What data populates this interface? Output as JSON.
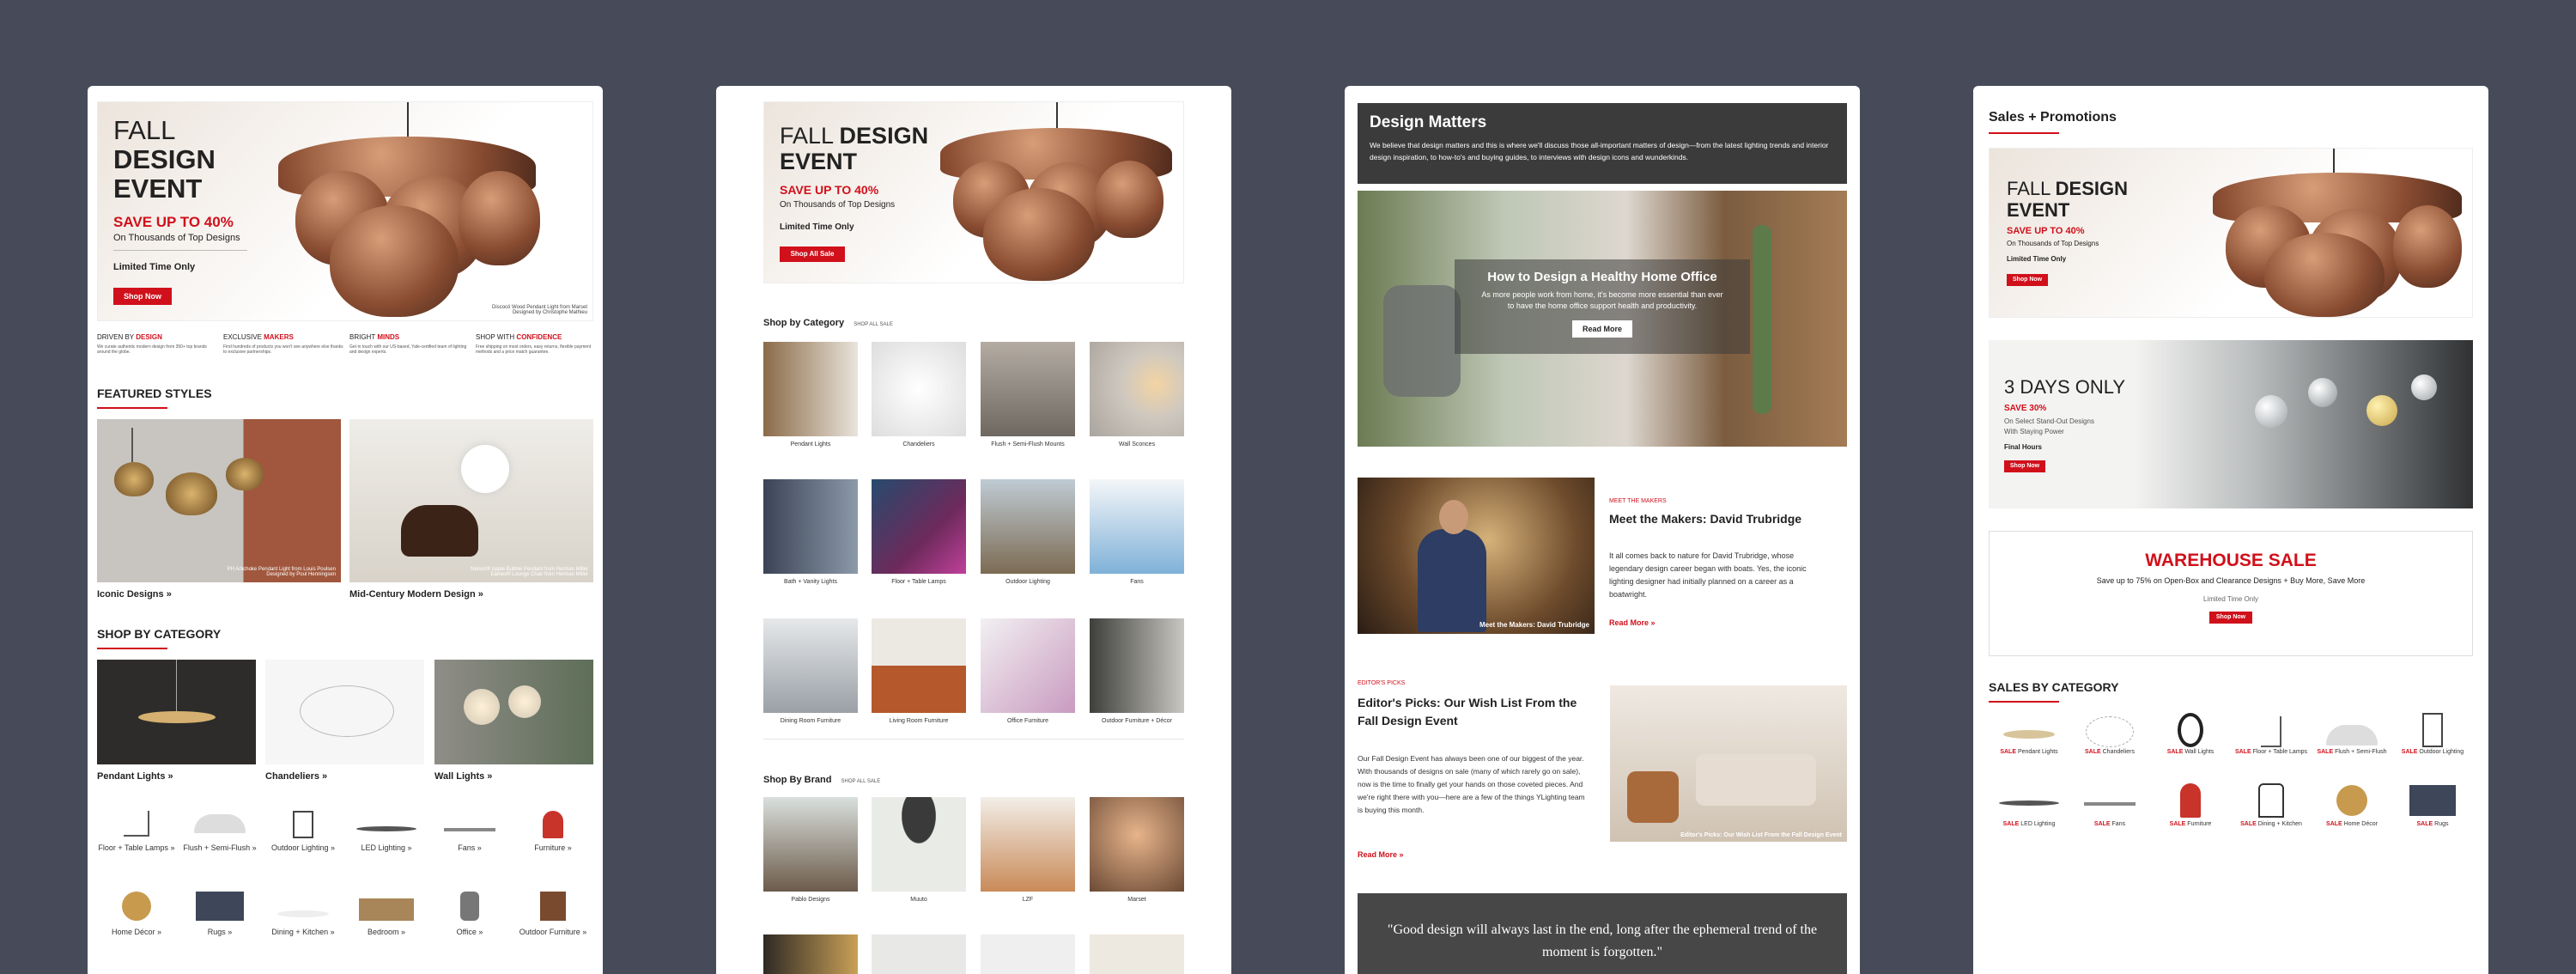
{
  "panel1": {
    "hero": {
      "fall": "FALL",
      "design": "DESIGN",
      "event": "EVENT",
      "save": "SAVE UP TO 40%",
      "sub": "On Thousands of Top Designs",
      "limited": "Limited Time Only",
      "button": "Shop Now",
      "credit": "Discocó Wood Pendant Light from Marset",
      "credit2": "Designed by Christophe Mathieu"
    },
    "values": [
      {
        "pre": "DRIVEN BY ",
        "key": "DESIGN",
        "text": "We curate authentic modern design from 350+ top brands around the globe."
      },
      {
        "pre": "EXCLUSIVE ",
        "key": "MAKERS",
        "text": "Find hundreds of products you won't see anywhere else thanks to exclusive partnerships."
      },
      {
        "pre": "BRIGHT ",
        "key": "MINDS",
        "text": "Get in touch with our US-based, Yale-certified team of lighting and design experts."
      },
      {
        "pre": "SHOP WITH ",
        "key": "CONFIDENCE",
        "text": "Free shipping on most orders, easy returns, flexible payment methods and a price match guarantee."
      }
    ],
    "featured_title": "FEATURED STYLES",
    "featured": [
      {
        "label": "Iconic Designs »",
        "overlay": "PH Artichoke Pendant Light from Louis Poulsen",
        "overlay2": "Designed by Poul Henningsen"
      },
      {
        "label": "Mid-Century Modern Design »",
        "overlay": "Nelson® Apple Bubble Pendant from Herman Miller",
        "overlay2": "Eames® Lounge Chair from Herman Miller"
      }
    ],
    "category_title": "SHOP BY CATEGORY",
    "categories": [
      "Pendant Lights »",
      "Chandeliers »",
      "Wall Lights »"
    ],
    "small": [
      "Floor + Table Lamps »",
      "Flush + Semi-Flush »",
      "Outdoor Lighting »",
      "LED Lighting »",
      "Fans »",
      "Furniture »",
      "Home Décor »",
      "Rugs »",
      "Dining + Kitchen »",
      "Bedroom »",
      "Office »",
      "Outdoor Furniture »"
    ]
  },
  "panel2": {
    "hero": {
      "fall": "FALL ",
      "design": "DESIGN",
      "event": "EVENT",
      "save": "SAVE UP TO 40%",
      "sub": "On Thousands of Top Designs",
      "limited": "Limited Time Only",
      "button": "Shop All Sale"
    },
    "cat_title": "Shop by Category",
    "cat_link": "SHOP ALL SALE",
    "categories": [
      "Pendant Lights",
      "Chandeliers",
      "Flush + Semi-Flush Mounts",
      "Wall Sconces",
      "Bath + Vanity Lights",
      "Floor + Table Lamps",
      "Outdoor Lighting",
      "Fans",
      "Dining Room Furniture",
      "Living Room Furniture",
      "Office Furniture",
      "Outdoor Furniture + Décor"
    ],
    "brand_title": "Shop By Brand",
    "brand_link": "SHOP ALL SALE",
    "brands": [
      "Pablo Designs",
      "Muuto",
      "LZF",
      "Marset"
    ]
  },
  "panel3": {
    "header_title": "Design Matters",
    "header_text": "We believe that design matters and this is where we'll discuss those all-important matters of design—from the latest lighting trends and interior design inspiration, to how-to's and buying guides, to interviews with design icons and wunderkinds.",
    "feature": {
      "title": "How to Design a Healthy Home Office",
      "text": "As more people work from home, it's become more essential than ever to have the home office support health and productivity.",
      "button": "Read More"
    },
    "makers": {
      "tag": "MEET THE MAKERS",
      "title": "Meet the Makers: David Trubridge",
      "text": "It all comes back to nature for David Trubridge, whose legendary design career began with boats. Yes, the iconic lighting designer had initially planned on a career as a boatwright.",
      "link": "Read More »",
      "caption": "Meet the Makers: David Trubridge"
    },
    "picks": {
      "tag": "EDITOR'S PICKS",
      "title": "Editor's Picks: Our Wish List From the Fall Design Event",
      "text": "Our Fall Design Event has always been one of our biggest of the year. With thousands of designs on sale (many of which rarely go on sale), now is the time to finally get your hands on those coveted pieces. And we're right there with you—here are a few of the things YLighting team is buying this month.",
      "link": "Read More »",
      "caption": "Editor's Picks: Our Wish List From the Fall Design Event"
    },
    "quote": "\"Good design will always last in the end, long after the ephemeral trend of the moment is forgotten.\""
  },
  "panel4": {
    "title": "Sales + Promotions",
    "hero": {
      "fall": "FALL ",
      "design": "DESIGN",
      "event": "EVENT",
      "save": "SAVE UP TO 40%",
      "sub": "On Thousands of Top Designs",
      "limited": "Limited Time Only",
      "button": "Shop Now"
    },
    "promo": {
      "title": "3 DAYS ONLY",
      "save": "SAVE 30%",
      "sub": "On Select Stand-Out Designs",
      "sub2": "With Staying Power",
      "final": "Final Hours",
      "button": "Shop Now"
    },
    "warehouse": {
      "title": "WAREHOUSE SALE",
      "text": "Save up to 75% on Open-Box and Clearance Designs + Buy More, Save More",
      "limited": "Limited Time Only",
      "button": "Shop Now"
    },
    "sales_title": "SALES BY CATEGORY",
    "sale_word": "SALE",
    "sales": [
      "Pendant Lights",
      "Chandeliers",
      "Wall Lights",
      "Floor + Table Lamps",
      "Flush + Semi-Flush",
      "Outdoor Lighting",
      "LED Lighting",
      "Fans",
      "Furniture",
      "Dining + Kitchen",
      "Home Décor",
      "Rugs"
    ]
  }
}
